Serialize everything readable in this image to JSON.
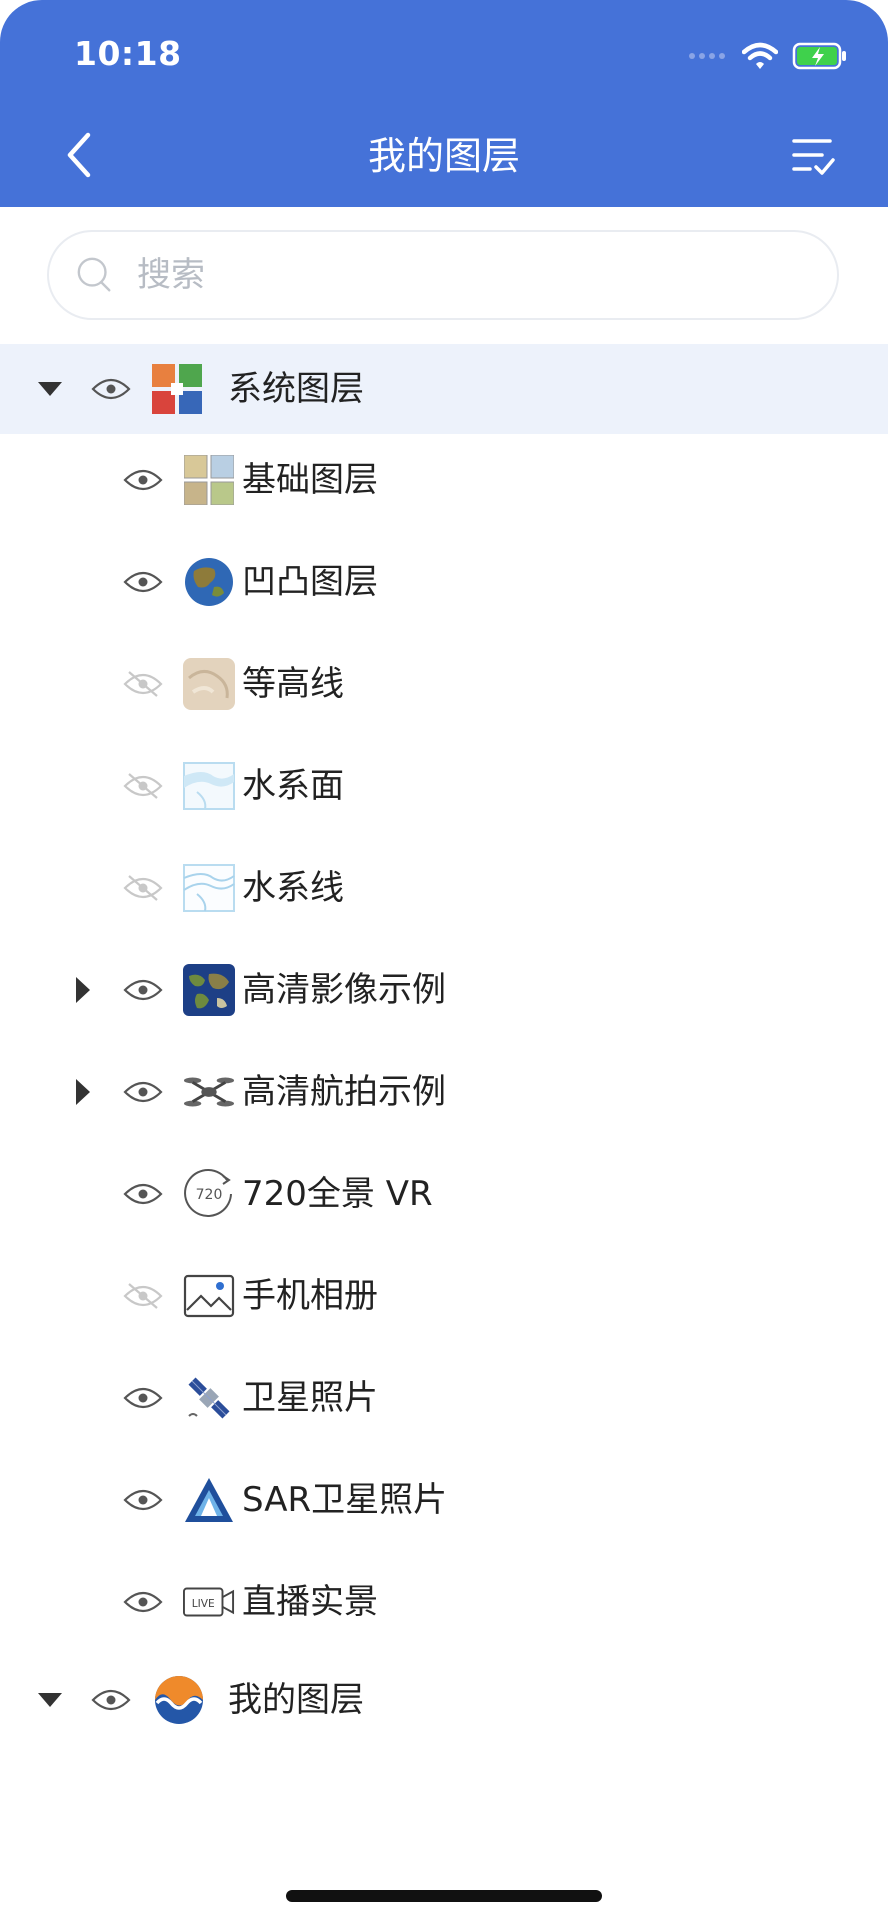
{
  "status_bar": {
    "time": "10:18"
  },
  "nav": {
    "title": "我的图层"
  },
  "search": {
    "placeholder": "搜索"
  },
  "colors": {
    "header": "#4572d8",
    "selected_row": "#edf2fb",
    "eye_on": "#555555",
    "eye_off": "#c8c8c8"
  },
  "tree": {
    "system_group": {
      "label": "系统图层",
      "expanded": true,
      "visible": true,
      "icon": "system-layers-icon"
    },
    "items": [
      {
        "label": "基础图层",
        "visible": true,
        "icon": "basemap-grid-icon"
      },
      {
        "label": "凹凸图层",
        "visible": true,
        "icon": "globe-icon"
      },
      {
        "label": "等高线",
        "visible": false,
        "icon": "contour-map-icon"
      },
      {
        "label": "水系面",
        "visible": false,
        "icon": "water-area-icon"
      },
      {
        "label": "水系线",
        "visible": false,
        "icon": "water-line-icon"
      },
      {
        "label": "高清影像示例",
        "visible": true,
        "icon": "satellite-imagery-icon",
        "expandable": true
      },
      {
        "label": "高清航拍示例",
        "visible": true,
        "icon": "drone-icon",
        "expandable": true
      },
      {
        "label": "720全景 VR",
        "visible": true,
        "icon": "panorama-720-icon"
      },
      {
        "label": "手机相册",
        "visible": false,
        "icon": "photo-album-icon"
      },
      {
        "label": "卫星照片",
        "visible": true,
        "icon": "satellite-icon"
      },
      {
        "label": "SAR卫星照片",
        "visible": true,
        "icon": "sar-satellite-icon"
      },
      {
        "label": "直播实景",
        "visible": true,
        "icon": "live-camera-icon"
      }
    ],
    "my_group": {
      "label": "我的图层",
      "expanded": true,
      "visible": true,
      "icon": "my-layers-icon"
    }
  }
}
